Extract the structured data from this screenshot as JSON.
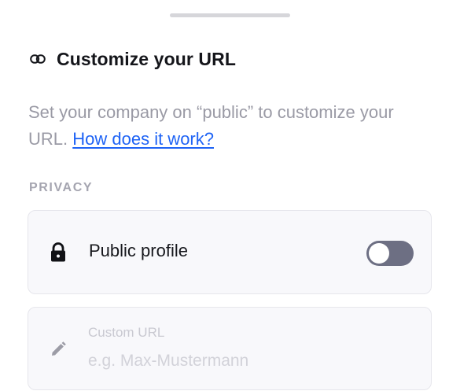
{
  "sheet": {
    "handle": "drag-handle"
  },
  "header": {
    "icon": "link-icon",
    "title": "Customize your URL"
  },
  "description": {
    "text": "Set your company on “public” to customize your URL. ",
    "link_label": "How does it work?"
  },
  "privacy": {
    "section_label": "PRIVACY",
    "public_profile": {
      "icon": "lock-icon",
      "label": "Public profile",
      "toggle_state": "off"
    },
    "custom_url": {
      "icon": "pencil-icon",
      "label": "Custom URL",
      "placeholder": "e.g. Max-Mustermann",
      "value": ""
    }
  },
  "colors": {
    "accent_link": "#1e63f5",
    "toggle_off": "#6d6f83",
    "card_bg": "#f8f8fb"
  }
}
